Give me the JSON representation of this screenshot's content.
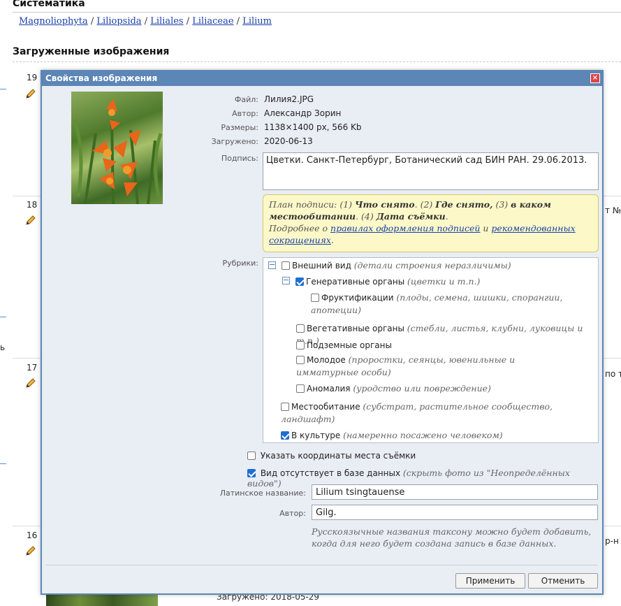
{
  "background": {
    "section_title": "Систематика",
    "breadcrumb": [
      "Magnoliophyta",
      "Liliopsida",
      "Liliales",
      "Liliaceae",
      "Lilium"
    ],
    "uploaded_title": "Загруженные изображения",
    "rows": [
      "19",
      "18",
      "17",
      "16"
    ],
    "right_snippets": [
      "т №",
      "по т",
      "р-н"
    ],
    "left_snippet": "ь",
    "bottom_uploaded_label": "Загружено:",
    "bottom_uploaded_value": "2018-05-29"
  },
  "dialog": {
    "title": "Свойства изображения",
    "close_icon": "close-icon",
    "file_label": "Файл:",
    "file_value": "Лилия2.JPG",
    "author_label": "Автор:",
    "author_value": "Александр Зорин",
    "size_label": "Размеры:",
    "size_value": "1138×1400 px, 566 Kb",
    "uploaded_label": "Загружено:",
    "uploaded_value": "2020-06-13",
    "caption_label": "Подпись:",
    "caption_value": "Цветки. Санкт-Петербург, Ботанический сад БИН РАН. 29.06.2013.",
    "hint": {
      "p1": "План подписи: (1) ",
      "b1": "Что снято",
      "p2": ". (2) ",
      "b2": "Где снято,",
      "p3": " (3) ",
      "b3": "в каком местообитании",
      "p4": ". (4) ",
      "b4": "Дата съёмки",
      "p5": ".",
      "p6": "Подробнее о ",
      "link1": "правилах оформления подписей",
      "p7": " и ",
      "link2": "рекомендованных сокращениях",
      "p8": "."
    },
    "rubrics_label": "Рубрики:",
    "rubrics": {
      "r1": {
        "label": "Внешний вид",
        "note": "(детали строения неразличимы)",
        "checked": false
      },
      "r2": {
        "label": "Генеративные органы",
        "note": "(цветки и т.п.)",
        "checked": true
      },
      "r3": {
        "label": "Фруктификации",
        "note": "(плоды, семена, шишки, спорангии, апотеции)",
        "checked": false
      },
      "r4": {
        "label": "Вегетативные органы",
        "note": "(стебли, листья, клубни, луковицы и т.п.)",
        "checked": false
      },
      "r5": {
        "label": "Подземные органы",
        "note": "",
        "checked": false
      },
      "r6": {
        "label": "Молодое",
        "note": "(проростки, сеянцы, ювенильные и имматурные особи)",
        "checked": false
      },
      "r7": {
        "label": "Аномалия",
        "note": "(уродство или повреждение)",
        "checked": false
      },
      "r8": {
        "label": "Местообитание",
        "note": "(субстрат, растительное сообщество, ландшафт)",
        "checked": false
      },
      "r9": {
        "label": "В культуре",
        "note": "(намеренно посажено человеком)",
        "checked": true
      }
    },
    "coords_label": "Указать координаты места съёмки",
    "coords_checked": false,
    "missing_label": "Вид отсутствует в базе данных",
    "missing_note": "(скрыть фото из \"Неопределённых видов\")",
    "missing_checked": true,
    "latin_label": "Латинское название:",
    "latin_value": "Lilium tsingtauense",
    "taxon_author_label": "Автор:",
    "taxon_author_value": "Gilg.",
    "note": "Русскоязычные названия таксону можно будет добавить, когда для него будет создана запись в базе данных.",
    "apply_label": "Применить",
    "cancel_label": "Отменить"
  }
}
